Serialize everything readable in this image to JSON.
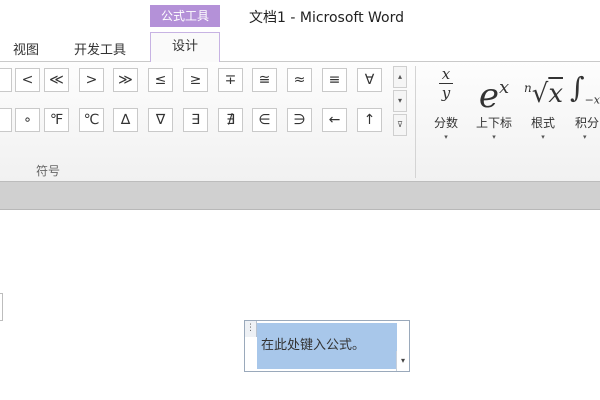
{
  "window": {
    "context_tab": "公式工具",
    "title": "文档1  -  Microsoft Word"
  },
  "tabs": [
    {
      "label": "视图"
    },
    {
      "label": "开发工具"
    },
    {
      "label": "设计"
    }
  ],
  "ribbon": {
    "symbols_row1": [
      "<",
      "≪",
      ">",
      "≫",
      "≤",
      "≥",
      "∓",
      "≅",
      "≈",
      "≡",
      "∀"
    ],
    "symbols_row2": [
      "∘",
      "℉",
      "℃",
      "∆",
      "∇",
      "∃",
      "∄",
      "∈",
      "∋",
      "←",
      "↑"
    ],
    "scroll_up": "▴",
    "scroll_down": "▾",
    "scroll_more": "⊽",
    "group_label": "符号",
    "structures": [
      {
        "glyph_top": "x",
        "glyph_bottom": "y",
        "label": "分数"
      },
      {
        "glyph_base": "e",
        "glyph_sup": "x",
        "label": "上下标"
      },
      {
        "glyph_index": "n",
        "glyph_radical": "√",
        "glyph_radicand": "x",
        "label": "根式"
      },
      {
        "glyph_integral": "∫",
        "glyph_sub": "−x",
        "label": "积分"
      }
    ],
    "dropdown_arrow": "▾"
  },
  "document": {
    "equation_placeholder": "在此处键入公式。",
    "equation_handle": "⋮",
    "equation_dropdown": "▾"
  }
}
